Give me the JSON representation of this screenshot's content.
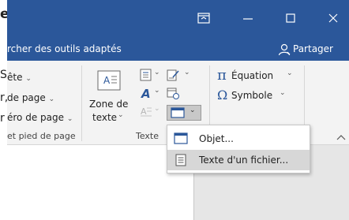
{
  "left_cut": {
    "title_fragment": "e",
    "fragments": [
      "S",
      "r,",
      "r"
    ]
  },
  "titlebar": {
    "controls": [
      "ribbon-display-icon",
      "minimize-icon",
      "maximize-icon",
      "close-icon"
    ]
  },
  "tellme": {
    "text": "rcher des outils adaptés",
    "share_label": "Partager"
  },
  "ribbon": {
    "header_footer": {
      "items": [
        "ête",
        "de page",
        "éro de page"
      ],
      "group_label": "et pied de page"
    },
    "text_group": {
      "textbox_label_1": "Zone de",
      "textbox_label_2": "texte",
      "group_label": "Texte"
    },
    "symbols_group": {
      "equation_label": "Équation",
      "symbol_label": "Symbole",
      "pi_glyph": "π",
      "omega_glyph": "Ω"
    }
  },
  "dropdown": {
    "items": [
      {
        "label": "Objet...",
        "highlighted": false
      },
      {
        "label": "Texte d'un fichier...",
        "highlighted": true
      }
    ]
  },
  "colors": {
    "titlebar": "#2b579a",
    "ribbon": "#f3f3f3",
    "menu_highlight": "#d7d7d7"
  }
}
